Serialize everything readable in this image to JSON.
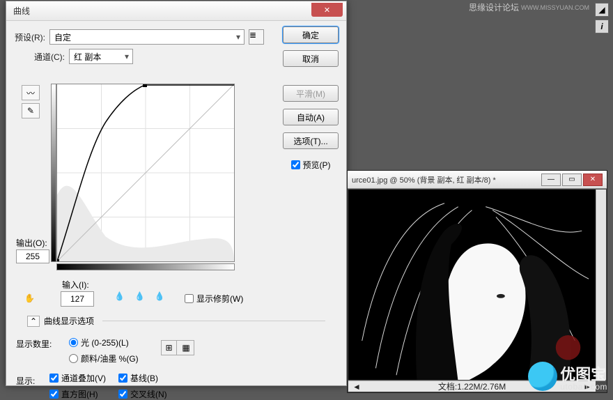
{
  "dialog": {
    "title": "曲线",
    "preset_label": "预设(R):",
    "preset_value": "自定",
    "channel_label": "通道(C):",
    "channel_value": "红 副本",
    "output_label": "输出(O):",
    "output_value": "255",
    "input_label": "输入(I):",
    "input_value": "127",
    "show_clip_label": "显示修剪(W)",
    "expand_label": "曲线显示选项",
    "display_amount_label": "显示数里:",
    "radio_light": "光 (0-255)(L)",
    "radio_ink": "颜料/油墨 %(G)",
    "show_label": "显示:",
    "check_channel_overlay": "通道叠加(V)",
    "check_baseline": "基线(B)",
    "check_histogram": "直方图(H)",
    "check_intersection": "交叉线(N)"
  },
  "buttons": {
    "ok": "确定",
    "cancel": "取消",
    "smooth": "平滑(M)",
    "auto": "自动(A)",
    "options": "选项(T)...",
    "preview": "预览(P)"
  },
  "chart_data": {
    "type": "line",
    "title": "曲线",
    "xlabel": "输入",
    "ylabel": "输出",
    "xlim": [
      0,
      255
    ],
    "ylim": [
      0,
      255
    ],
    "series": [
      {
        "name": "baseline",
        "x": [
          0,
          255
        ],
        "y": [
          0,
          255
        ]
      },
      {
        "name": "curve",
        "x": [
          0,
          20,
          40,
          64,
          90,
          127,
          170,
          200,
          255
        ],
        "y": [
          0,
          60,
          125,
          185,
          225,
          248,
          253,
          255,
          255
        ]
      }
    ],
    "control_points": [
      {
        "x": 0,
        "y": 0
      },
      {
        "x": 127,
        "y": 255
      }
    ],
    "current": {
      "input": 127,
      "output": 255
    }
  },
  "image_window": {
    "title": "urce01.jpg @ 50% (背景 副本, 红 副本/8) *",
    "status": "文档:1.22M/2.76M"
  },
  "forum": {
    "text": "思缘设计论坛",
    "url": "WWW.MISSYUAN.COM"
  },
  "watermark": {
    "cn": "优图宝",
    "url": "utobao.com"
  },
  "icons": {
    "curve_tool": "〰",
    "pencil_tool": "✎",
    "menu": "≣",
    "hand": "✋",
    "eyedrop_black": "⧈",
    "eyedrop_gray": "⧉",
    "eyedrop_white": "⧇",
    "expand_arrow": "⌃",
    "grid_coarse": "⊞",
    "grid_fine": "▦",
    "hist": "◢",
    "info": "i"
  }
}
